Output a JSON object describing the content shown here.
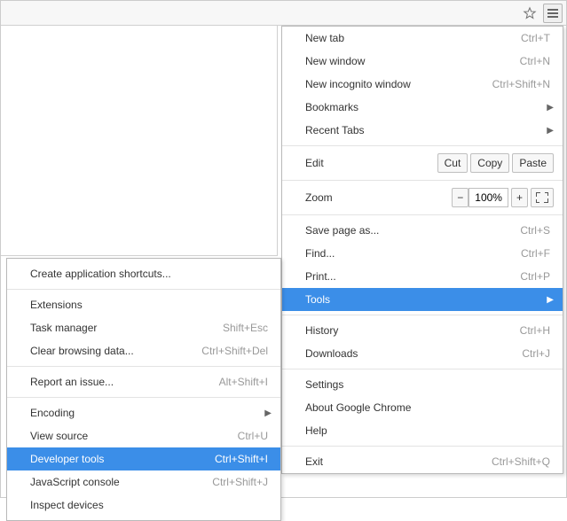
{
  "toolbar": {
    "star_title": "Bookmark this page",
    "menu_title": "Customize and control Google Chrome"
  },
  "main_menu": {
    "new_tab": {
      "label": "New tab",
      "shortcut": "Ctrl+T"
    },
    "new_window": {
      "label": "New window",
      "shortcut": "Ctrl+N"
    },
    "new_incognito": {
      "label": "New incognito window",
      "shortcut": "Ctrl+Shift+N"
    },
    "bookmarks": {
      "label": "Bookmarks"
    },
    "recent_tabs": {
      "label": "Recent Tabs"
    },
    "edit": {
      "label": "Edit",
      "cut": "Cut",
      "copy": "Copy",
      "paste": "Paste"
    },
    "zoom": {
      "label": "Zoom",
      "minus": "−",
      "value": "100%",
      "plus": "+"
    },
    "save_as": {
      "label": "Save page as...",
      "shortcut": "Ctrl+S"
    },
    "find": {
      "label": "Find...",
      "shortcut": "Ctrl+F"
    },
    "print": {
      "label": "Print...",
      "shortcut": "Ctrl+P"
    },
    "tools": {
      "label": "Tools"
    },
    "history": {
      "label": "History",
      "shortcut": "Ctrl+H"
    },
    "downloads": {
      "label": "Downloads",
      "shortcut": "Ctrl+J"
    },
    "settings": {
      "label": "Settings"
    },
    "about": {
      "label": "About Google Chrome"
    },
    "help": {
      "label": "Help"
    },
    "exit": {
      "label": "Exit",
      "shortcut": "Ctrl+Shift+Q"
    }
  },
  "tools_submenu": {
    "create_shortcuts": {
      "label": "Create application shortcuts..."
    },
    "extensions": {
      "label": "Extensions"
    },
    "task_manager": {
      "label": "Task manager",
      "shortcut": "Shift+Esc"
    },
    "clear_data": {
      "label": "Clear browsing data...",
      "shortcut": "Ctrl+Shift+Del"
    },
    "report_issue": {
      "label": "Report an issue...",
      "shortcut": "Alt+Shift+I"
    },
    "encoding": {
      "label": "Encoding"
    },
    "view_source": {
      "label": "View source",
      "shortcut": "Ctrl+U"
    },
    "developer_tools": {
      "label": "Developer tools",
      "shortcut": "Ctrl+Shift+I"
    },
    "js_console": {
      "label": "JavaScript console",
      "shortcut": "Ctrl+Shift+J"
    },
    "inspect_devices": {
      "label": "Inspect devices"
    }
  }
}
